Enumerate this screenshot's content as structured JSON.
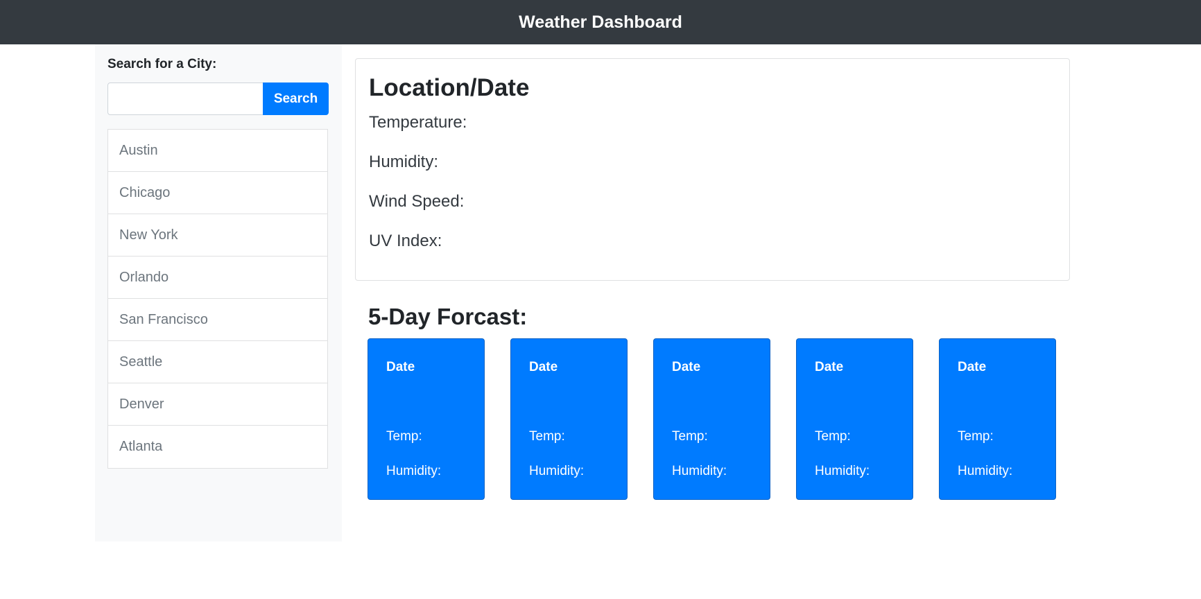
{
  "header": {
    "title": "Weather Dashboard"
  },
  "sidebar": {
    "search_label": "Search for a City:",
    "search_value": "",
    "search_button": "Search",
    "cities": [
      "Austin",
      "Chicago",
      "New York",
      "Orlando",
      "San Francisco",
      "Seattle",
      "Denver",
      "Atlanta"
    ]
  },
  "current": {
    "title": "Location/Date",
    "temperature_label": "Temperature:",
    "humidity_label": "Humidity:",
    "wind_label": "Wind Speed:",
    "uv_label": "UV Index:"
  },
  "forecast": {
    "title": "5-Day Forcast:",
    "days": [
      {
        "date": "Date",
        "temp": "Temp:",
        "humidity": "Humidity:"
      },
      {
        "date": "Date",
        "temp": "Temp:",
        "humidity": "Humidity:"
      },
      {
        "date": "Date",
        "temp": "Temp:",
        "humidity": "Humidity:"
      },
      {
        "date": "Date",
        "temp": "Temp:",
        "humidity": "Humidity:"
      },
      {
        "date": "Date",
        "temp": "Temp:",
        "humidity": "Humidity:"
      }
    ]
  },
  "colors": {
    "navbar": "#343a40",
    "accent": "#007bff",
    "sidebar_bg": "#f8f9fa"
  }
}
